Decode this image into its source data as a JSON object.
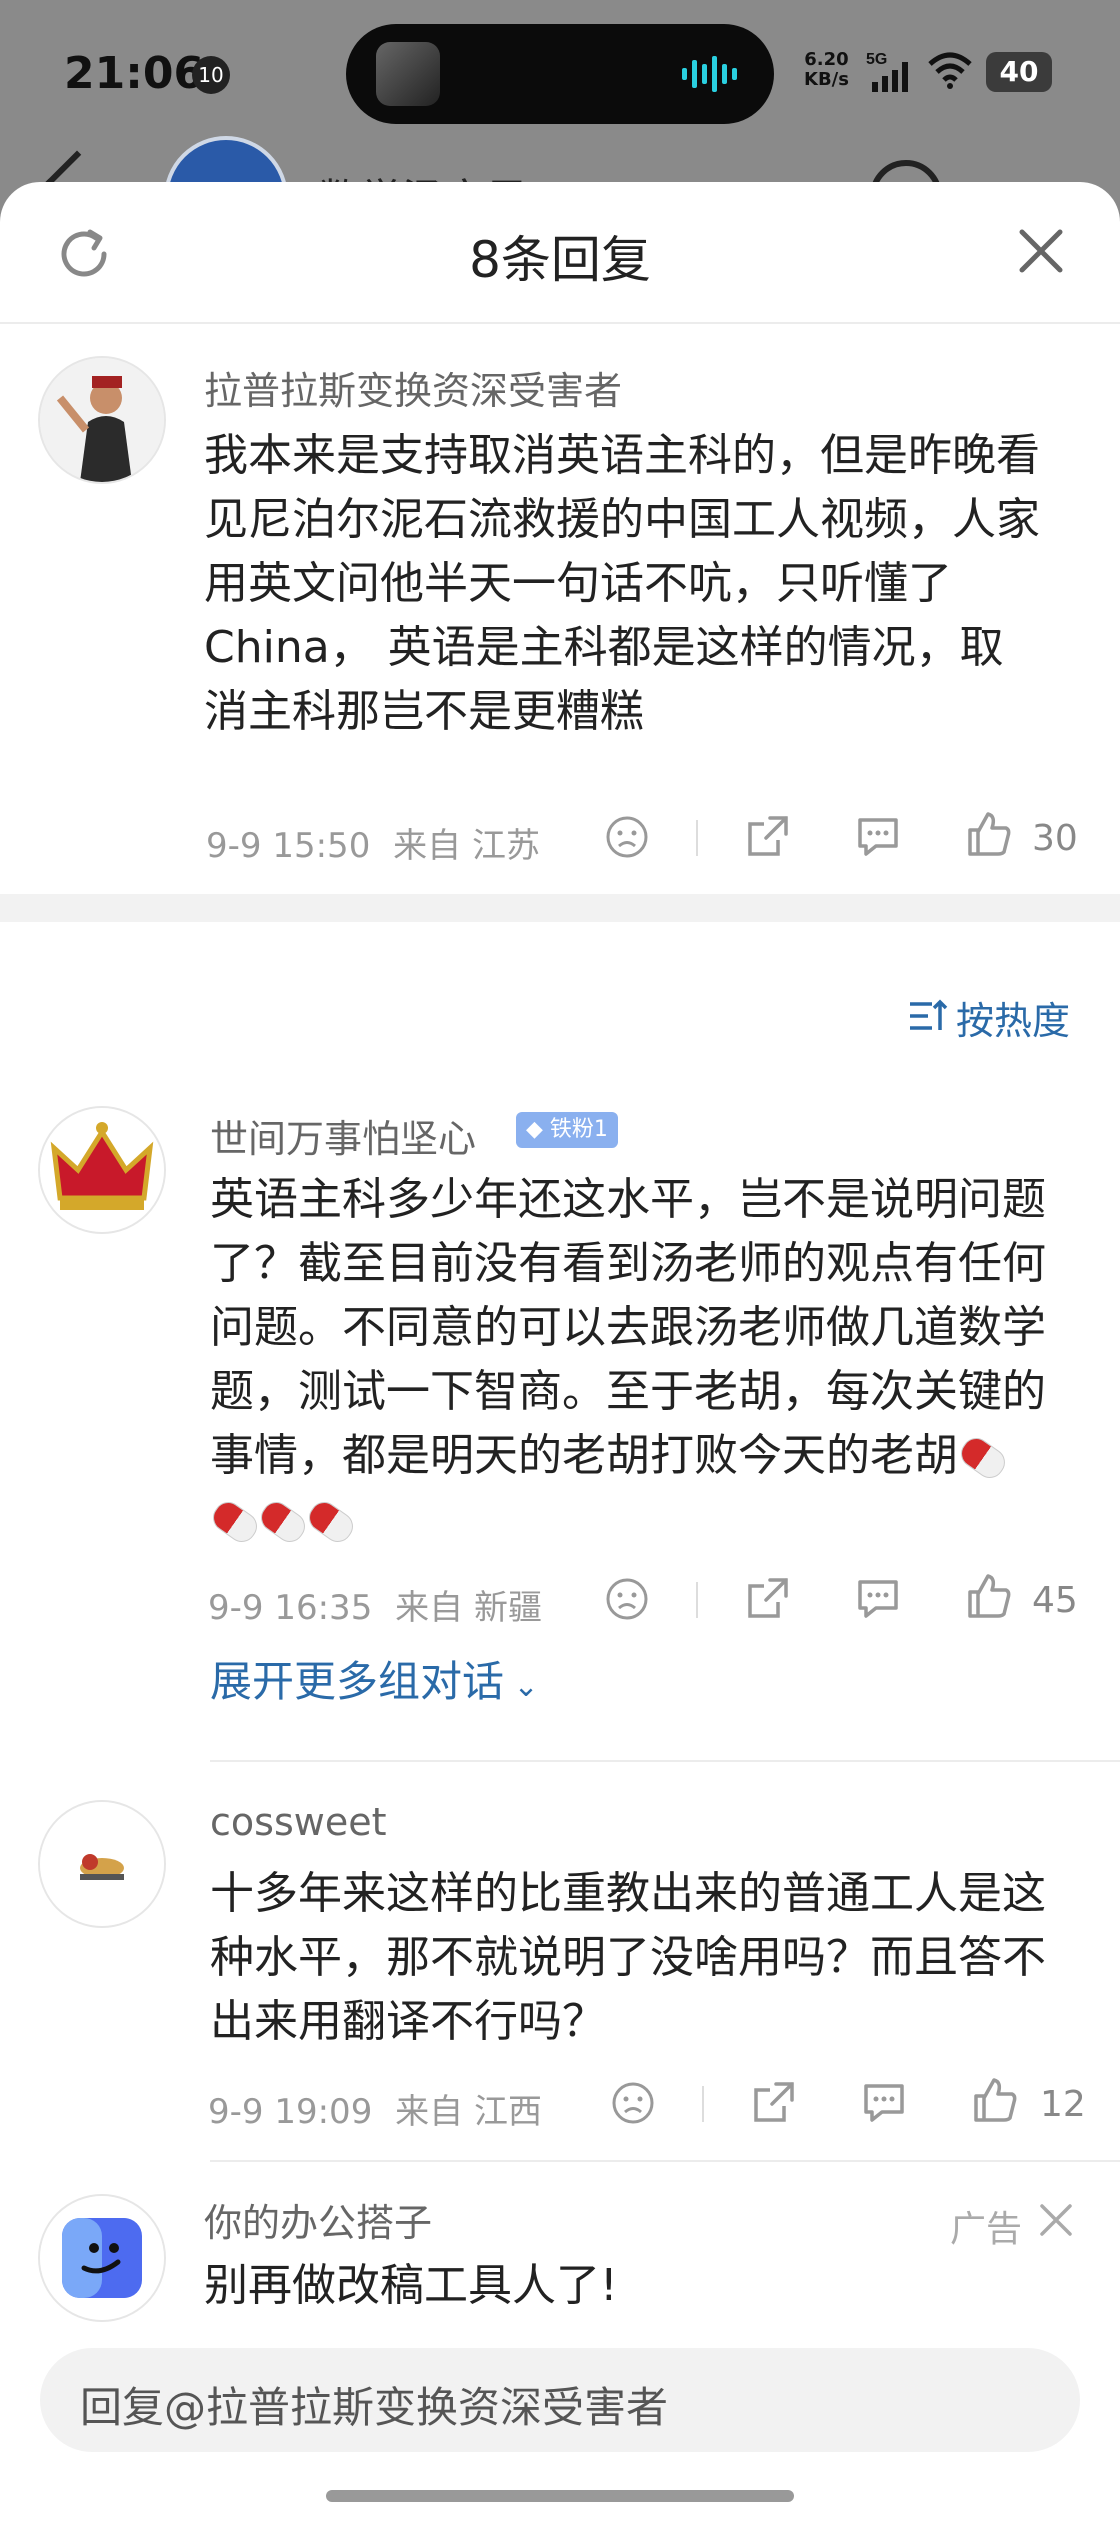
{
  "status_bar": {
    "time": "21:06",
    "notification_count": "10",
    "net_speed_value": "6.20",
    "net_speed_unit": "KB/s",
    "network": "5G",
    "battery": "40"
  },
  "background_page": {
    "title_partial": "数学汤家凤"
  },
  "sheet": {
    "title": "8条回复",
    "refresh_icon": "refresh-icon",
    "close_icon": "close-icon"
  },
  "root_comment": {
    "username": "拉普拉斯变换资深受害者",
    "content": "我本来是支持取消英语主科的，但是昨晚看见尼泊尔泥石流救援的中国工人视频，人家用英文问他半天一句话不吭，只听懂了China， 英语是主科都是这样的情况，取消主科那岂不是更糟糕",
    "date": "9-9 15:50",
    "location": "来自 江苏",
    "likes": "30"
  },
  "sort_label": "按热度",
  "replies": [
    {
      "username": "世间万事怕坚心",
      "badge": "铁粉1",
      "content": "英语主科多少年还这水平，岂不是说明问题了？截至目前没有看到汤老师的观点有任何问题。不同意的可以去跟汤老师做几道数学题，测试一下智商。至于老胡，每次关键的事情，都是明天的老胡打败今天的老胡",
      "date": "9-9 16:35",
      "location": "来自 新疆",
      "likes": "45",
      "expand": "展开更多组对话"
    },
    {
      "username": "cossweet",
      "content": "十多年来这样的比重教出来的普通工人是这种水平，那不就说明了没啥用吗？而且答不出来用翻译不行吗？",
      "date": "9-9 19:09",
      "location": "来自 江西",
      "likes": "12"
    }
  ],
  "ad": {
    "username": "你的办公搭子",
    "content": "别再做改稿工具人了!",
    "label": "广告"
  },
  "reply_input": {
    "placeholder": "回复@拉普拉斯变换资深受害者"
  },
  "colors": {
    "link_blue": "#2a6aa8",
    "badge_blue": "#8ab0ef",
    "meta_gray": "#999999"
  }
}
